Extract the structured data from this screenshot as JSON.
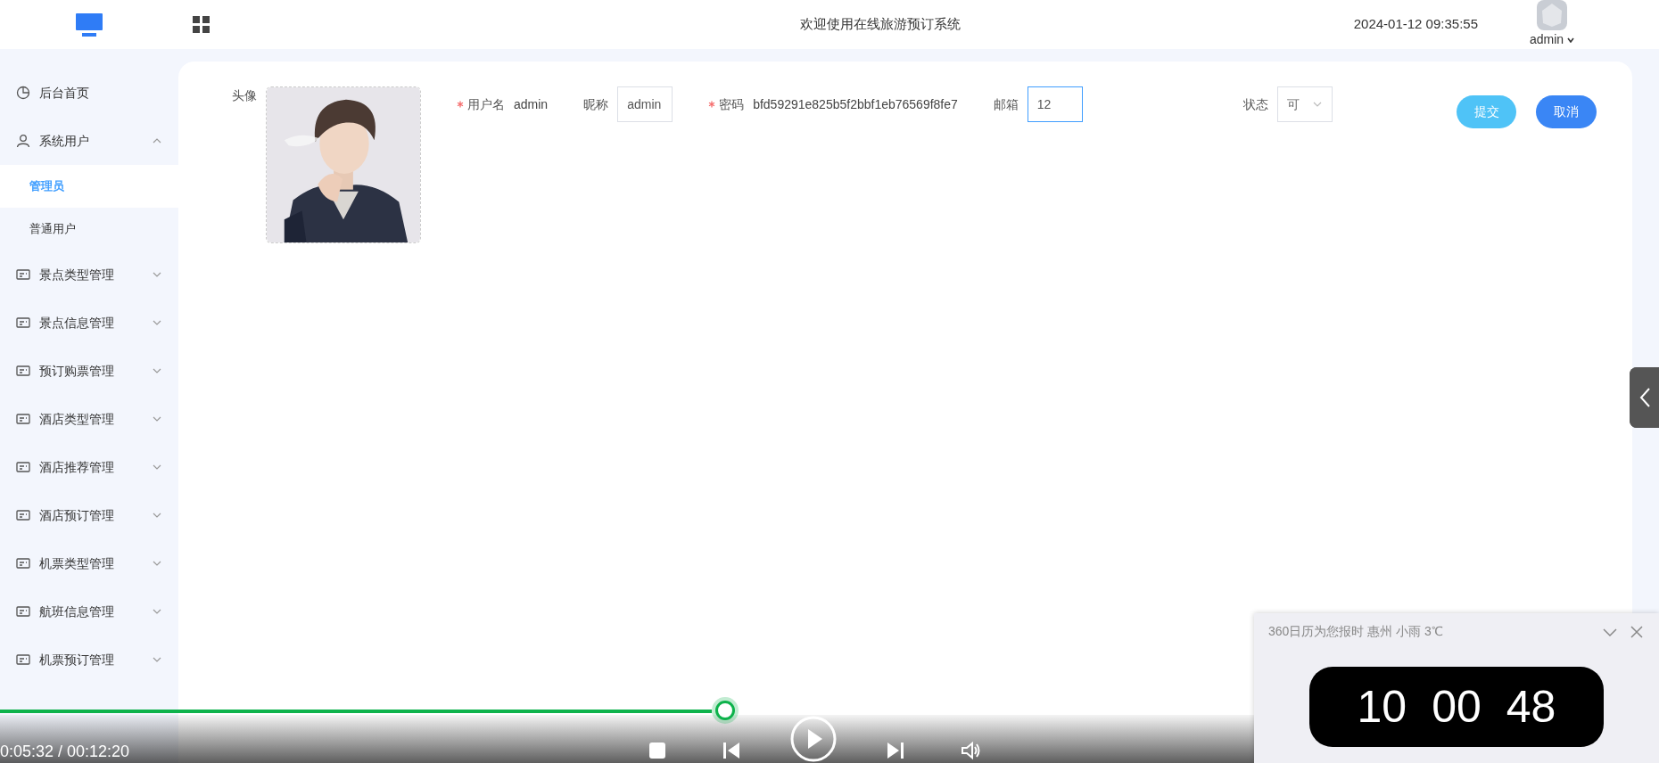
{
  "header": {
    "title": "欢迎使用在线旅游预订系统",
    "datetime": "2024-01-12 09:35:55",
    "user": "admin"
  },
  "sidebar": {
    "items": [
      {
        "kind": "link",
        "label": "后台首页"
      },
      {
        "kind": "group",
        "label": "系统用户",
        "expanded": true,
        "children": [
          {
            "label": "管理员",
            "selected": true
          },
          {
            "label": "普通用户",
            "selected": false
          }
        ]
      },
      {
        "kind": "group",
        "label": "景点类型管理",
        "expanded": false
      },
      {
        "kind": "group",
        "label": "景点信息管理",
        "expanded": false
      },
      {
        "kind": "group",
        "label": "预订购票管理",
        "expanded": false
      },
      {
        "kind": "group",
        "label": "酒店类型管理",
        "expanded": false
      },
      {
        "kind": "group",
        "label": "酒店推荐管理",
        "expanded": false
      },
      {
        "kind": "group",
        "label": "酒店预订管理",
        "expanded": false
      },
      {
        "kind": "group",
        "label": "机票类型管理",
        "expanded": false
      },
      {
        "kind": "group",
        "label": "航班信息管理",
        "expanded": false
      },
      {
        "kind": "group",
        "label": "机票预订管理",
        "expanded": false
      }
    ]
  },
  "form": {
    "fields": [
      {
        "kind": "avatar",
        "label": "头像"
      },
      {
        "kind": "static",
        "label": "用户名",
        "required": true,
        "value": "admin"
      },
      {
        "kind": "input",
        "label": "昵称",
        "required": false,
        "value": "admin",
        "focused": false
      },
      {
        "kind": "static",
        "label": "密码",
        "required": true,
        "value": "bfd59291e825b5f2bbf1eb76569f8fe7"
      },
      {
        "kind": "input",
        "label": "邮箱",
        "required": false,
        "value": "12",
        "focused": true
      },
      {
        "kind": "select",
        "label": "状态",
        "required": false,
        "value": "可"
      }
    ],
    "buttons": [
      {
        "kind": "submit",
        "label": "提交"
      },
      {
        "kind": "cancel",
        "label": "取消"
      }
    ]
  },
  "player": {
    "progress": {
      "level": 0.437
    },
    "time": "0:05:32 / 00:12:20"
  },
  "widget": {
    "title": "360日历为您报时 惠州 小雨 3℃",
    "clock": [
      "10",
      "00",
      "48"
    ]
  }
}
